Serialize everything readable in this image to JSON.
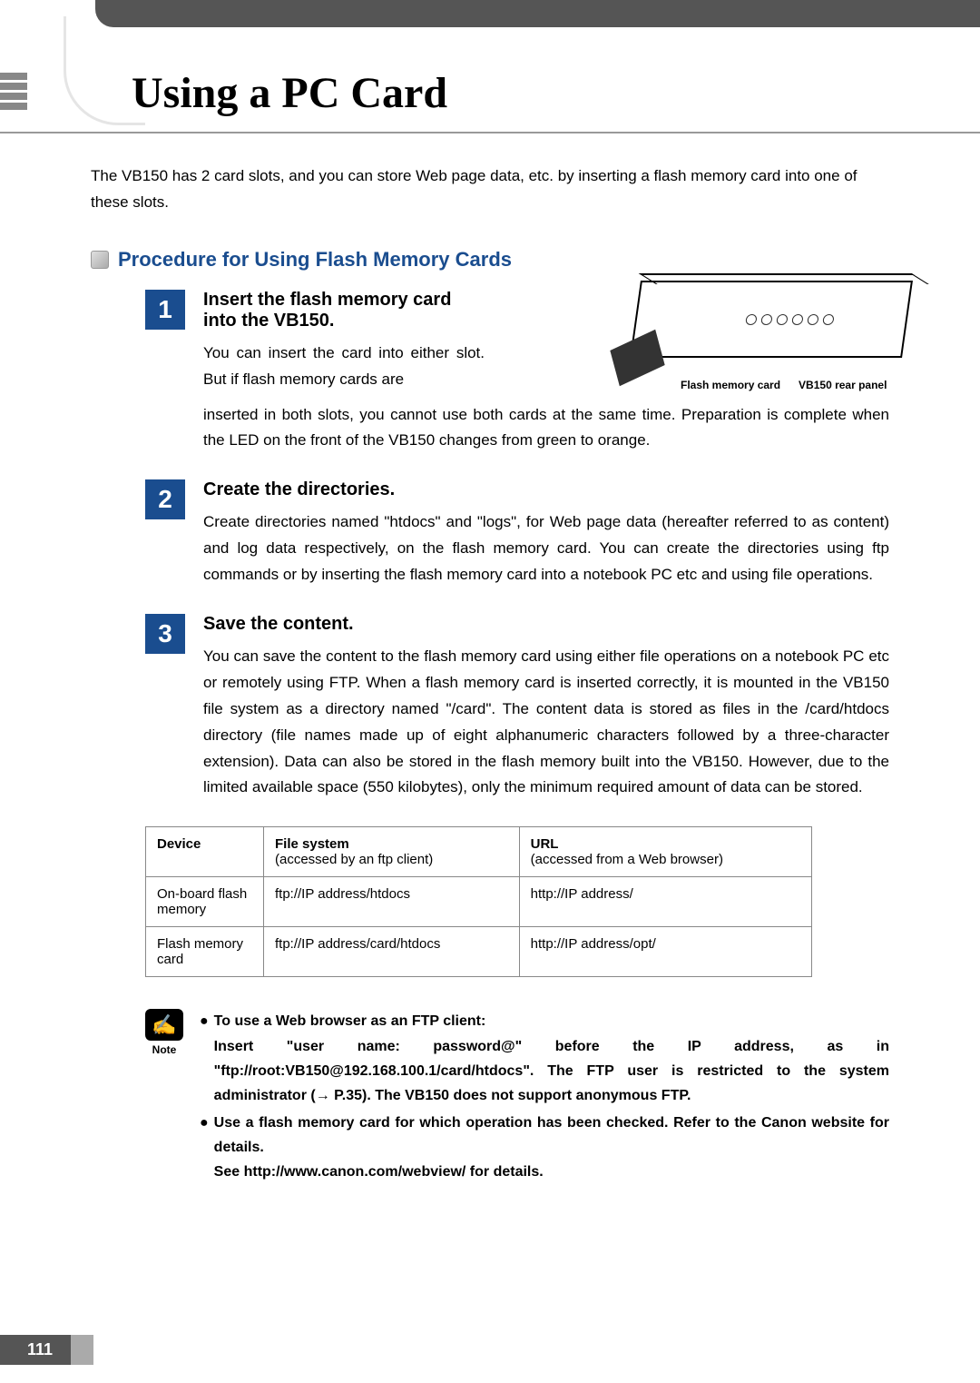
{
  "page_title": "Using a PC Card",
  "intro": "The VB150 has 2 card slots, and you can store Web page data, etc. by inserting a flash memory card into one of these slots.",
  "section_heading": "Procedure for Using Flash Memory Cards",
  "steps": [
    {
      "num": "1",
      "title": "Insert the flash memory card into the VB150.",
      "text_narrow": "You can insert the card into either slot. But if flash memory cards are",
      "text_wide": "inserted in both slots, you cannot use both cards at the same time. Preparation is complete when the LED on the front of the VB150 changes from green to orange."
    },
    {
      "num": "2",
      "title": "Create the directories.",
      "text": "Create directories named \"htdocs\" and \"logs\", for Web page data (hereafter referred to as content) and log data respectively, on the flash memory card. You can create the directories using ftp commands or by inserting the flash memory card into a notebook PC etc and using file operations."
    },
    {
      "num": "3",
      "title": "Save the content.",
      "text": "You can save the content to the flash memory card using either file operations on a notebook PC etc or remotely using FTP. When a flash memory card is inserted correctly, it is mounted in the VB150 file system as a directory named \"/card\". The content data is stored as files in the /card/htdocs directory (file names made up of eight alphanumeric characters followed by a three-character extension). Data can also be stored in the flash memory built into the VB150. However, due to the limited available space (550 kilobytes), only the minimum required amount of data can be stored."
    }
  ],
  "diagram_labels": {
    "card": "Flash memory card",
    "panel": "VB150 rear panel"
  },
  "table": {
    "headers": [
      {
        "main": "Device",
        "sub": ""
      },
      {
        "main": "File system",
        "sub": "(accessed by an ftp client)"
      },
      {
        "main": "URL",
        "sub": "(accessed from a Web browser)"
      }
    ],
    "rows": [
      [
        "On-board flash memory",
        "ftp://IP address/htdocs",
        "http://IP address/"
      ],
      [
        "Flash memory card",
        "ftp://IP address/card/htdocs",
        "http://IP address/opt/"
      ]
    ]
  },
  "note": {
    "label": "Note",
    "items": [
      {
        "heading": "To use a Web browser as an FTP client:",
        "body": "Insert \"user name: password@\" before the IP address, as in \"ftp://root:VB150@192.168.100.1/card/htdocs\". The FTP user is restricted to the system administrator (→ P.35). The VB150 does not support anonymous FTP."
      },
      {
        "heading": "Use a flash memory card for which operation has been checked. Refer to the Canon website for details.",
        "body": "See http://www.canon.com/webview/ for details."
      }
    ]
  },
  "page_number": "111"
}
